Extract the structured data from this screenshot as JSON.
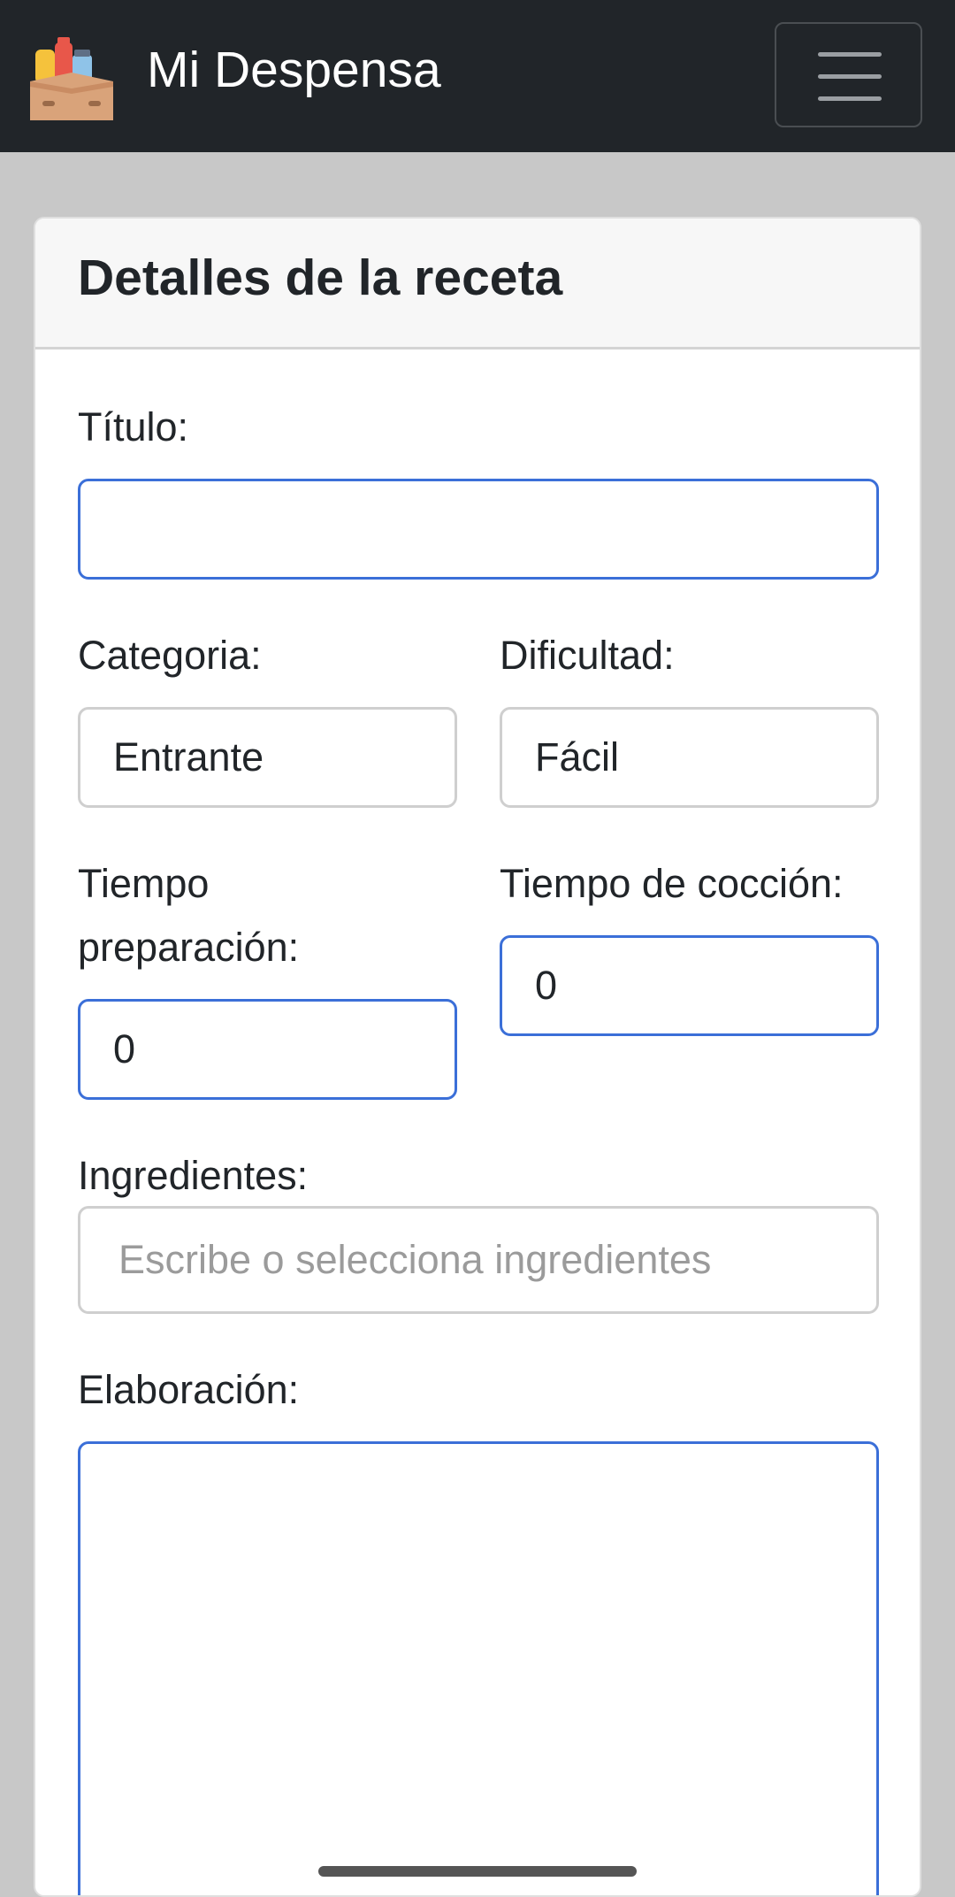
{
  "navbar": {
    "brand": "Mi Despensa",
    "logo_icon": "pantry-box-icon",
    "menu_icon": "hamburger-menu-icon"
  },
  "card": {
    "title": "Detalles de la receta"
  },
  "form": {
    "titulo": {
      "label": "Título:",
      "value": ""
    },
    "categoria": {
      "label": "Categoria:",
      "value": "Entrante"
    },
    "dificultad": {
      "label": "Dificultad:",
      "value": "Fácil"
    },
    "tiempo_preparacion": {
      "label_line1": "Tiempo",
      "label_line2": "preparación:",
      "value": "0"
    },
    "tiempo_coccion": {
      "label": "Tiempo de cocción:",
      "value": "0"
    },
    "ingredientes": {
      "label": "Ingredientes:",
      "placeholder": "Escribe o selecciona ingredientes"
    },
    "elaboracion": {
      "label": "Elaboración:",
      "value": ""
    }
  },
  "colors": {
    "navbar": "#212529",
    "focus_border": "#3b6fd8",
    "background": "#c8c8c8"
  }
}
